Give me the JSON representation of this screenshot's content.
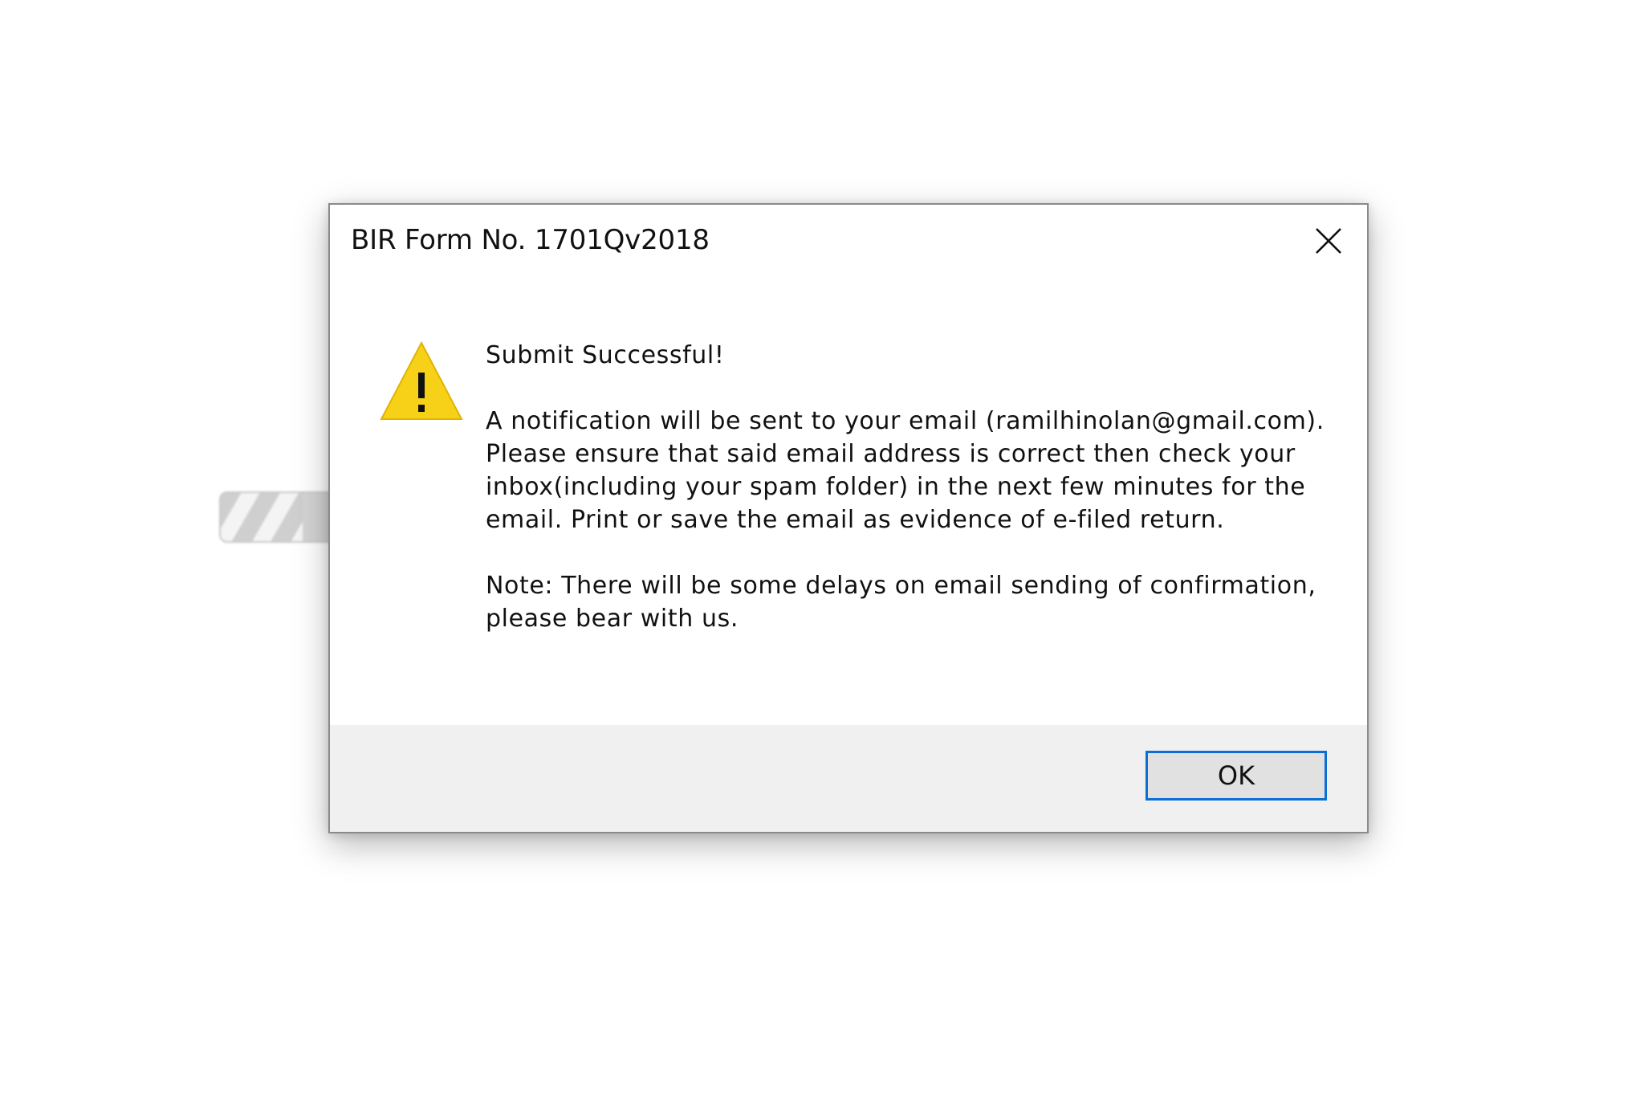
{
  "background_progress": {
    "fill_fraction": 0.7
  },
  "dialog": {
    "title": "BIR Form No. 1701Qv2018",
    "close_icon": "close-icon",
    "message_icon": "warning-icon",
    "message": {
      "headline": "Submit Successful!",
      "body": "A notification will be sent to your email (ramilhinolan@gmail.com). Please ensure that said email address is correct then check your inbox(including your spam folder) in the next few minutes for the email. Print or save the email as evidence of e-filed return.",
      "note": "Note: There will be some delays on email sending of confirmation, please bear with us."
    },
    "ok_label": "OK"
  },
  "colors": {
    "accent": "#0b6fd6",
    "warning": "#f7d117",
    "footer_bg": "#f0f0f0"
  }
}
